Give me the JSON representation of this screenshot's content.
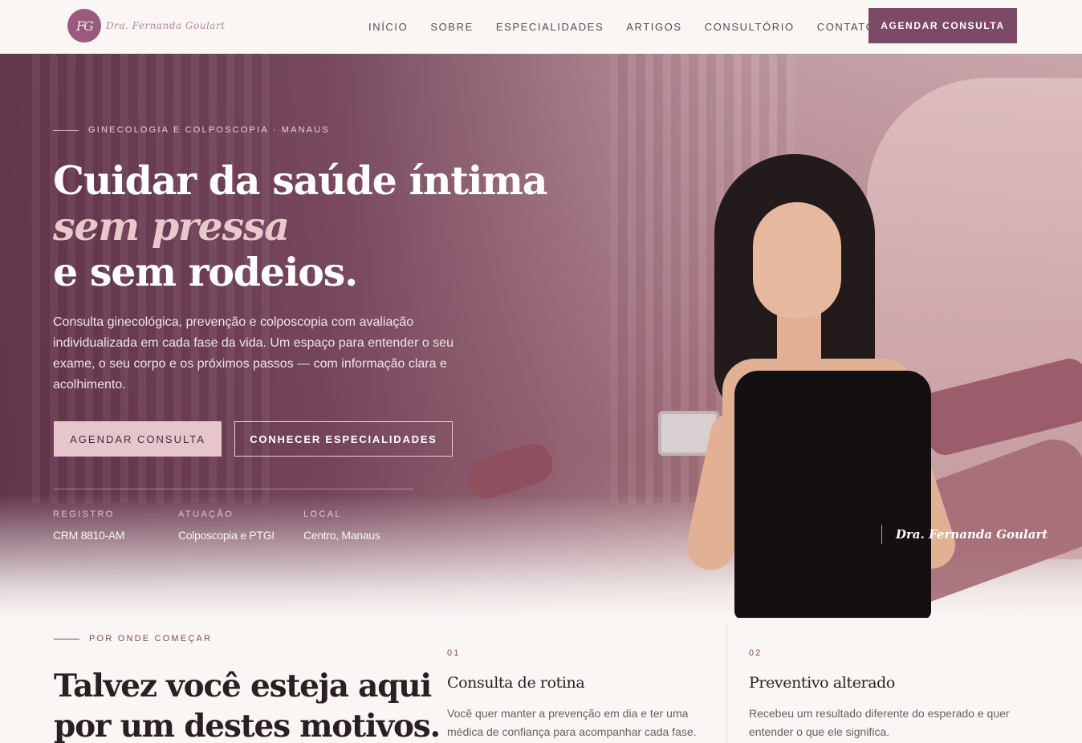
{
  "header": {
    "logo_monogram": "FG",
    "logo_script": "Dra. Fernanda Goulart",
    "nav": [
      "INÍCIO",
      "SOBRE",
      "ESPECIALIDADES",
      "ARTIGOS",
      "CONSULTÓRIO",
      "CONTATO"
    ],
    "cta_label": "AGENDAR CONSULTA"
  },
  "hero": {
    "eyebrow": "GINECOLOGIA E COLPOSCOPIA · MANAUS",
    "title_line1": "Cuidar da saúde íntima",
    "title_line2": "sem pressa",
    "title_line3": "e sem rodeios.",
    "lead": "Consulta ginecológica, prevenção e colposcopia com avaliação individualizada em cada fase da vida. Um espaço para entender o seu exame, o seu corpo e os próximos passos — com informação clara e acolhimento.",
    "primary_button": "AGENDAR CONSULTA",
    "secondary_button": "CONHECER ESPECIALIDADES",
    "facts": [
      {
        "label": "REGISTRO",
        "value": "CRM 8810-AM"
      },
      {
        "label": "ATUAÇÃO",
        "value": "Colposcopia e PTGI"
      },
      {
        "label": "LOCAL",
        "value": "Centro, Manaus"
      }
    ],
    "signature": "Dra. Fernanda Goulart"
  },
  "reasons": {
    "eyebrow": "POR ONDE COMEÇAR",
    "title_line1": "Talvez você esteja aqui",
    "title_line2": "por um destes motivos.",
    "cards": [
      {
        "number": "01",
        "title": "Consulta de rotina",
        "text": "Você quer manter a prevenção em dia e ter uma médica de confiança para acompanhar cada fase."
      },
      {
        "number": "02",
        "title": "Preventivo alterado",
        "text": "Recebeu um resultado diferente do esperado e quer entender o que ele significa."
      }
    ]
  },
  "colors": {
    "brand": "#7c4a66",
    "hero_overlay": "#5f3248",
    "button_light": "#e6c6cc"
  }
}
